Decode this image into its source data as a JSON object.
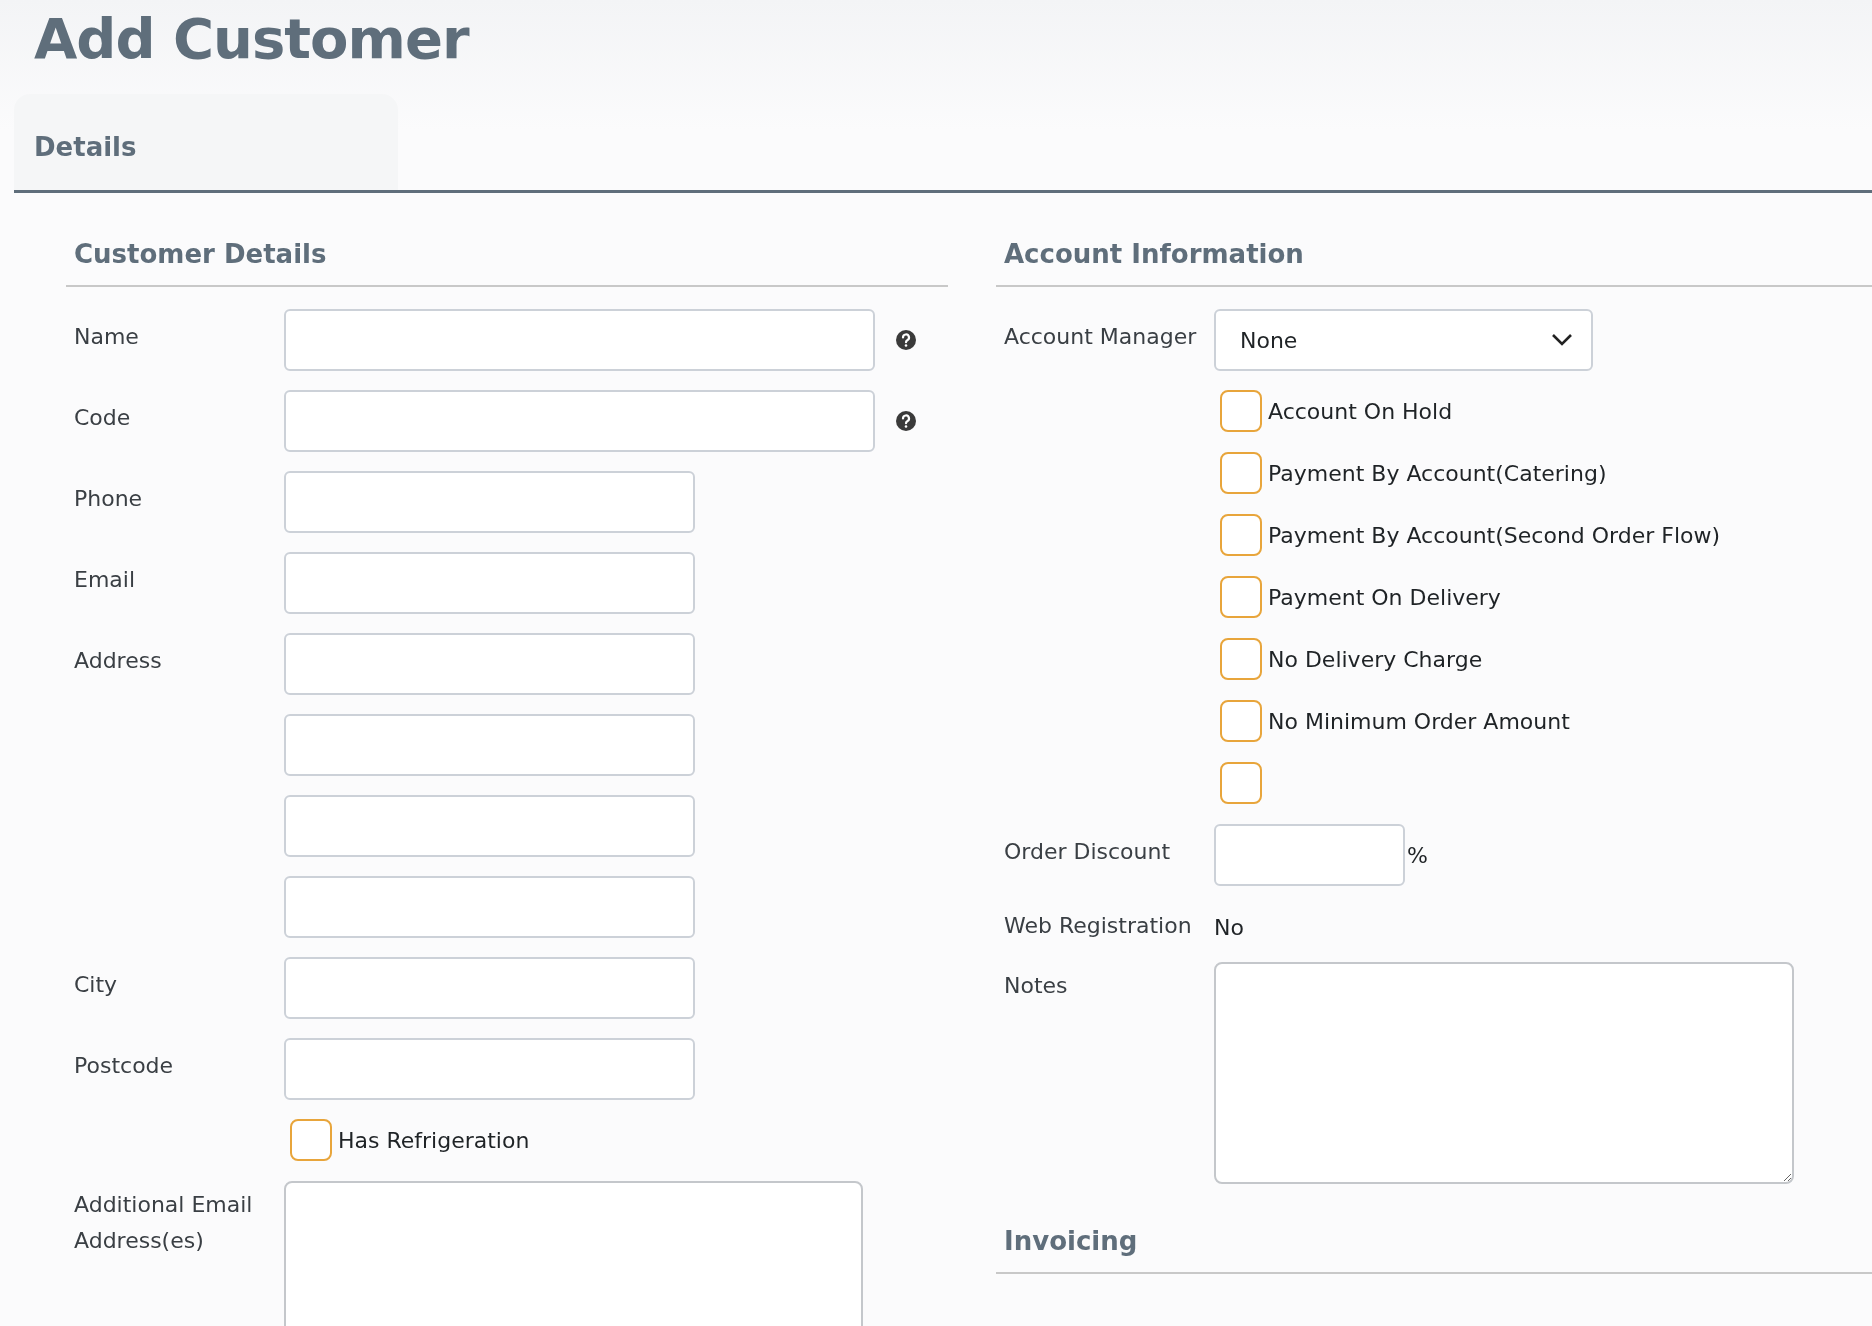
{
  "title": "Add Customer",
  "tabs": [
    {
      "label": "Details",
      "selected": true
    }
  ],
  "customer_details": {
    "heading": "Customer Details",
    "fields": [
      {
        "kind": "text_help",
        "label": "Name"
      },
      {
        "kind": "text_help",
        "label": "Code"
      },
      {
        "kind": "text",
        "label": "Phone"
      },
      {
        "kind": "text",
        "label": "Email"
      },
      {
        "kind": "text",
        "label": "Address"
      },
      {
        "kind": "text"
      },
      {
        "kind": "text"
      },
      {
        "kind": "text"
      },
      {
        "kind": "text",
        "label": "City"
      },
      {
        "kind": "text",
        "label": "Postcode"
      },
      {
        "kind": "checkbox",
        "label": "Has Refrigeration",
        "checked": false
      },
      {
        "kind": "textarea",
        "label": "Additional Email Address(es)"
      }
    ]
  },
  "account_information": {
    "heading": "Account Information",
    "fields": [
      {
        "kind": "select",
        "label": "Account Manager",
        "value": "None"
      },
      {
        "kind": "checkbox",
        "label": "Account On Hold",
        "checked": false
      },
      {
        "kind": "checkbox",
        "label": "Payment By Account(Catering)",
        "checked": false
      },
      {
        "kind": "checkbox",
        "label": "Payment By Account(Second Order Flow)",
        "checked": false
      },
      {
        "kind": "checkbox",
        "label": "Payment On Delivery",
        "checked": false
      },
      {
        "kind": "checkbox",
        "label": "No Delivery Charge",
        "checked": false
      },
      {
        "kind": "checkbox",
        "label": "No Minimum Order Amount",
        "checked": false
      },
      {
        "kind": "checkbox",
        "checked": false
      },
      {
        "kind": "percent",
        "label": "Order Discount",
        "suffix": "%"
      },
      {
        "kind": "readonly",
        "label": "Web Registration",
        "value": "No"
      },
      {
        "kind": "notes",
        "label": "Notes"
      }
    ]
  },
  "invoicing": {
    "heading": "Invoicing"
  }
}
